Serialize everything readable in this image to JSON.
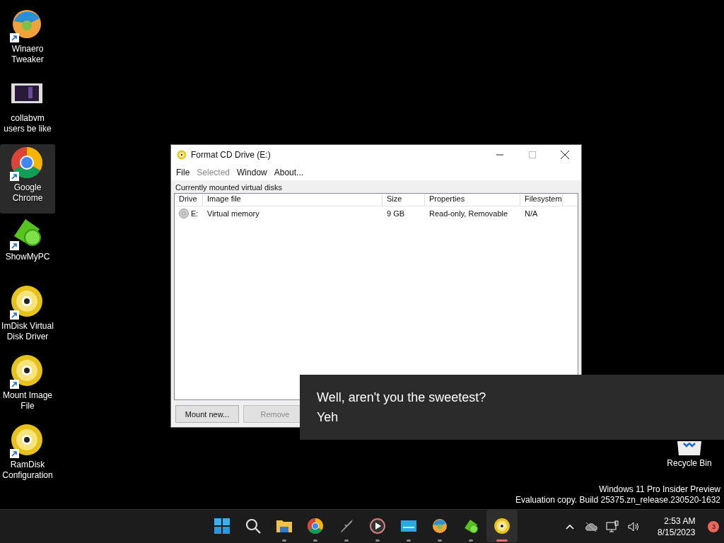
{
  "desktop_icons": [
    {
      "label": "Winaero Tweaker",
      "kind": "winaero",
      "shortcut": true,
      "selected": false
    },
    {
      "label": "collabvm users be like",
      "kind": "video",
      "shortcut": false,
      "selected": false
    },
    {
      "label": "Google Chrome",
      "kind": "chrome",
      "shortcut": true,
      "selected": true
    },
    {
      "label": "ShowMyPC",
      "kind": "showmypc",
      "shortcut": true,
      "selected": false
    },
    {
      "label": "ImDisk Virtual Disk Driver",
      "kind": "disc",
      "shortcut": true,
      "selected": false
    },
    {
      "label": "Mount Image File",
      "kind": "disc",
      "shortcut": true,
      "selected": false
    },
    {
      "label": "RamDisk Configuration",
      "kind": "disc",
      "shortcut": true,
      "selected": false
    }
  ],
  "recycle_bin": {
    "label": "Recycle Bin"
  },
  "window": {
    "title": "Format CD Drive (E:)",
    "menu": [
      {
        "label": "File",
        "disabled": false
      },
      {
        "label": "Selected",
        "disabled": true
      },
      {
        "label": "Window",
        "disabled": false
      },
      {
        "label": "About...",
        "disabled": false
      }
    ],
    "section_label": "Currently mounted virtual disks",
    "table": {
      "columns": [
        "Drive",
        "Image file",
        "Size",
        "Properties",
        "Filesystem"
      ],
      "rows": [
        [
          "E:",
          "Virtual memory",
          "9 GB",
          "Read-only, Removable",
          "N/A"
        ]
      ]
    },
    "buttons": [
      {
        "label": "Mount new...",
        "disabled": false
      },
      {
        "label": "Remove",
        "disabled": true
      }
    ]
  },
  "notification": {
    "lines": [
      "Well, aren't you the sweetest?",
      "Yeh"
    ]
  },
  "watermark_text": [
    "Windows 11 Pro Insider Preview",
    "Evaluation copy. Build 25375.zn_release.230520-1632"
  ],
  "taskbar": {
    "apps": [
      {
        "kind": "start",
        "running": false,
        "active": false
      },
      {
        "kind": "search",
        "running": false,
        "active": false
      },
      {
        "kind": "folder",
        "running": true,
        "active": false
      },
      {
        "kind": "chrome",
        "running": true,
        "active": false
      },
      {
        "kind": "plane",
        "running": true,
        "active": false
      },
      {
        "kind": "play",
        "running": true,
        "active": false
      },
      {
        "kind": "screen",
        "running": true,
        "active": false
      },
      {
        "kind": "winaero",
        "running": true,
        "active": false
      },
      {
        "kind": "showmypc",
        "running": true,
        "active": false
      },
      {
        "kind": "disc",
        "running": true,
        "active": true
      }
    ],
    "time": "2:53 AM",
    "date": "8/15/2023",
    "notification_count": "3"
  }
}
